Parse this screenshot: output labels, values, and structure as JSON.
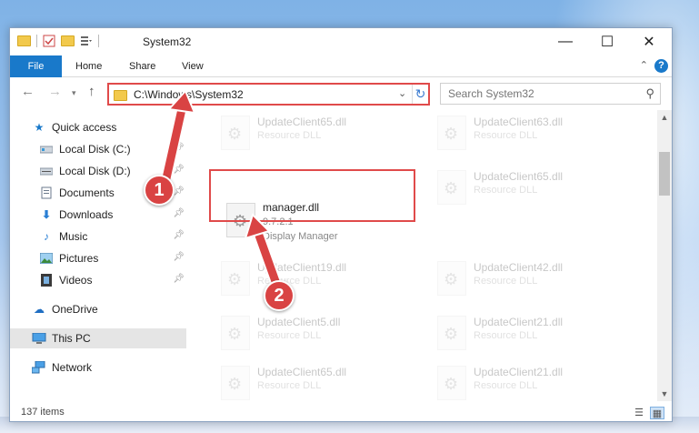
{
  "window": {
    "title": "System32",
    "controls": {
      "minimize": "—",
      "maximize": "☐",
      "close": "✕"
    }
  },
  "ribbon": {
    "tabs": [
      "File",
      "Home",
      "Share",
      "View"
    ],
    "help": "?"
  },
  "address": {
    "path": "C:\\Windows\\System32",
    "search_placeholder": "Search System32"
  },
  "sidebar": {
    "items": [
      {
        "label": "Quick access",
        "icon": "star-icon",
        "pinned": false
      },
      {
        "label": "Local Disk (C:)",
        "icon": "drive-icon",
        "pinned": true
      },
      {
        "label": "Local Disk (D:)",
        "icon": "drive-icon",
        "pinned": true
      },
      {
        "label": "Documents",
        "icon": "documents-icon",
        "pinned": true
      },
      {
        "label": "Downloads",
        "icon": "download-icon",
        "pinned": true
      },
      {
        "label": "Music",
        "icon": "music-icon",
        "pinned": true
      },
      {
        "label": "Pictures",
        "icon": "pictures-icon",
        "pinned": true
      },
      {
        "label": "Videos",
        "icon": "videos-icon",
        "pinned": true
      },
      {
        "label": "OneDrive",
        "icon": "cloud-icon",
        "pinned": false
      },
      {
        "label": "This PC",
        "icon": "pc-icon",
        "pinned": false,
        "selected": true
      },
      {
        "label": "Network",
        "icon": "network-icon",
        "pinned": false
      }
    ]
  },
  "files": [
    {
      "name": "UpdateClient65.dll",
      "sub": "Resource DLL"
    },
    {
      "name": "UpdateClient63.dll",
      "sub": "Resource DLL"
    },
    {
      "name": "manager.dll",
      "version": "9.7.2.1",
      "sub": "Display Manager",
      "highlighted": true
    },
    {
      "name": "UpdateClient65.dll",
      "sub": "Resource DLL"
    },
    {
      "name": "UpdateClient19.dll",
      "sub": "Resource DLL"
    },
    {
      "name": "UpdateClient42.dll",
      "sub": "Resource DLL"
    },
    {
      "name": "UpdateClient5.dll",
      "sub": "Resource DLL"
    },
    {
      "name": "UpdateClient21.dll",
      "sub": "Resource DLL"
    },
    {
      "name": "UpdateClient65.dll",
      "sub": "Resource DLL"
    },
    {
      "name": "UpdateClient21.dll",
      "sub": "Resource DLL"
    }
  ],
  "status": {
    "count": "137 items"
  },
  "callouts": {
    "step1": "1",
    "step2": "2"
  },
  "colors": {
    "accent": "#1979ca",
    "callout": "#d94343",
    "highlight_border": "#e04a4a"
  }
}
